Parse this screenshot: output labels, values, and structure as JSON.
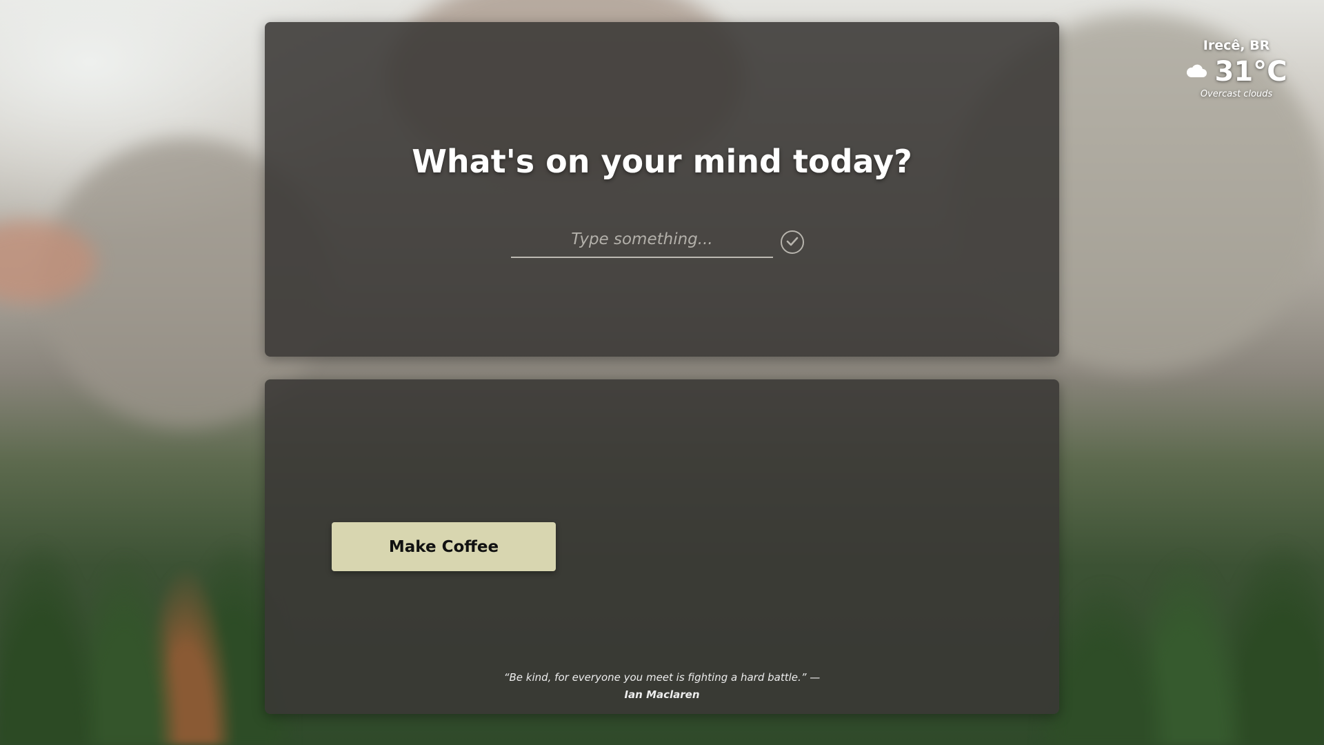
{
  "prompt": {
    "headline": "What's on your mind today?",
    "input_placeholder": "Type something...",
    "input_value": ""
  },
  "actions": {
    "make_coffee_label": "Make Coffee"
  },
  "quote": {
    "text": "“Be kind, for everyone you meet is fighting a hard battle.” —",
    "author": "Ian Maclaren"
  },
  "weather": {
    "location": "Irecê, BR",
    "temperature": "31°C",
    "condition": "Overcast clouds",
    "icon": "cloud-icon"
  },
  "colors": {
    "card_background": "#3a3835",
    "button_background": "#d8d6b0",
    "text": "#ffffff"
  }
}
